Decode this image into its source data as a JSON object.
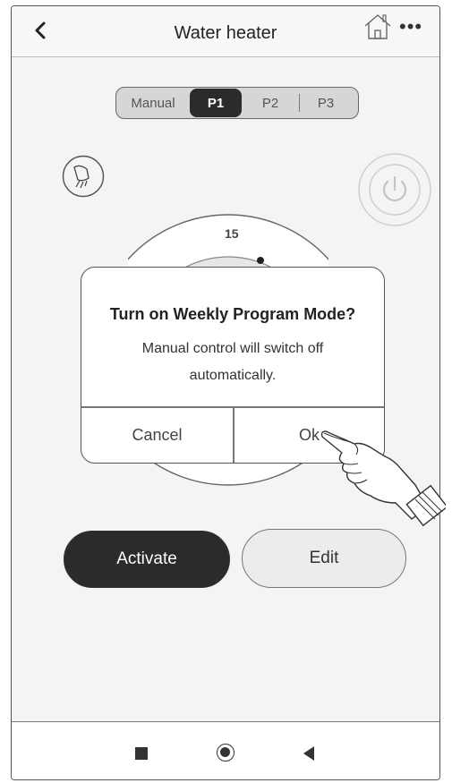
{
  "header": {
    "title": "Water heater",
    "back_icon": "chevron-left-icon",
    "home_icon": "home-icon",
    "more_label": "•••"
  },
  "mode_tabs": {
    "items": [
      "Manual",
      "P1",
      "P2",
      "P3"
    ],
    "selected": "P1"
  },
  "icons": {
    "left": "shower-icon",
    "right": "power-icon"
  },
  "dial": {
    "top_label": "15"
  },
  "actions": {
    "activate_label": "Activate",
    "edit_label": "Edit"
  },
  "dialog": {
    "title": "Turn on Weekly Program Mode?",
    "message_line1": "Manual control will switch off",
    "message_line2": "automatically.",
    "cancel_label": "Cancel",
    "ok_label": "Ok"
  },
  "navbar": {
    "items": [
      "recent-apps-icon",
      "home-circle-icon",
      "back-triangle-icon"
    ]
  },
  "colors": {
    "dark": "#2b2b2b",
    "background": "#f4f4f4",
    "border": "#555555"
  }
}
